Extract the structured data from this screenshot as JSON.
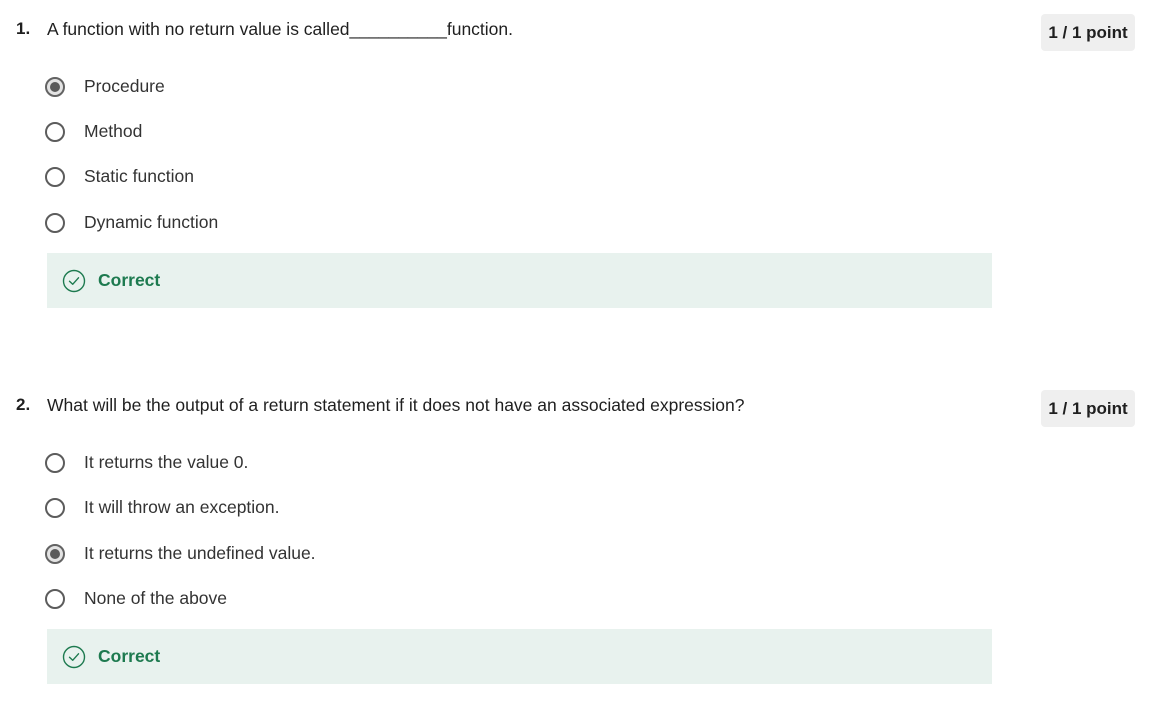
{
  "questions": [
    {
      "number": "1.",
      "text": "A function with no return value is called__________function.",
      "points": "1 / 1 point",
      "options": [
        {
          "label": "Procedure",
          "selected": true
        },
        {
          "label": "Method",
          "selected": false
        },
        {
          "label": "Static function",
          "selected": false
        },
        {
          "label": "Dynamic function",
          "selected": false
        }
      ],
      "feedback": "Correct"
    },
    {
      "number": "2.",
      "text": "What will be the output of a return statement if it does not have an associated expression?",
      "points": "1 / 1 point",
      "options": [
        {
          "label": "It returns the value 0.",
          "selected": false
        },
        {
          "label": "It will throw an exception.",
          "selected": false
        },
        {
          "label": "It returns the undefined value.",
          "selected": true
        },
        {
          "label": "None of the above",
          "selected": false
        }
      ],
      "feedback": "Correct"
    }
  ],
  "colors": {
    "correct_text": "#1d7a4f",
    "feedback_bg": "#e8f2ee",
    "points_bg": "#efefef"
  },
  "icons": {
    "feedback": "check-circle-icon",
    "selected_option": "radio-selected-icon",
    "unselected_option": "radio-unselected-icon"
  }
}
